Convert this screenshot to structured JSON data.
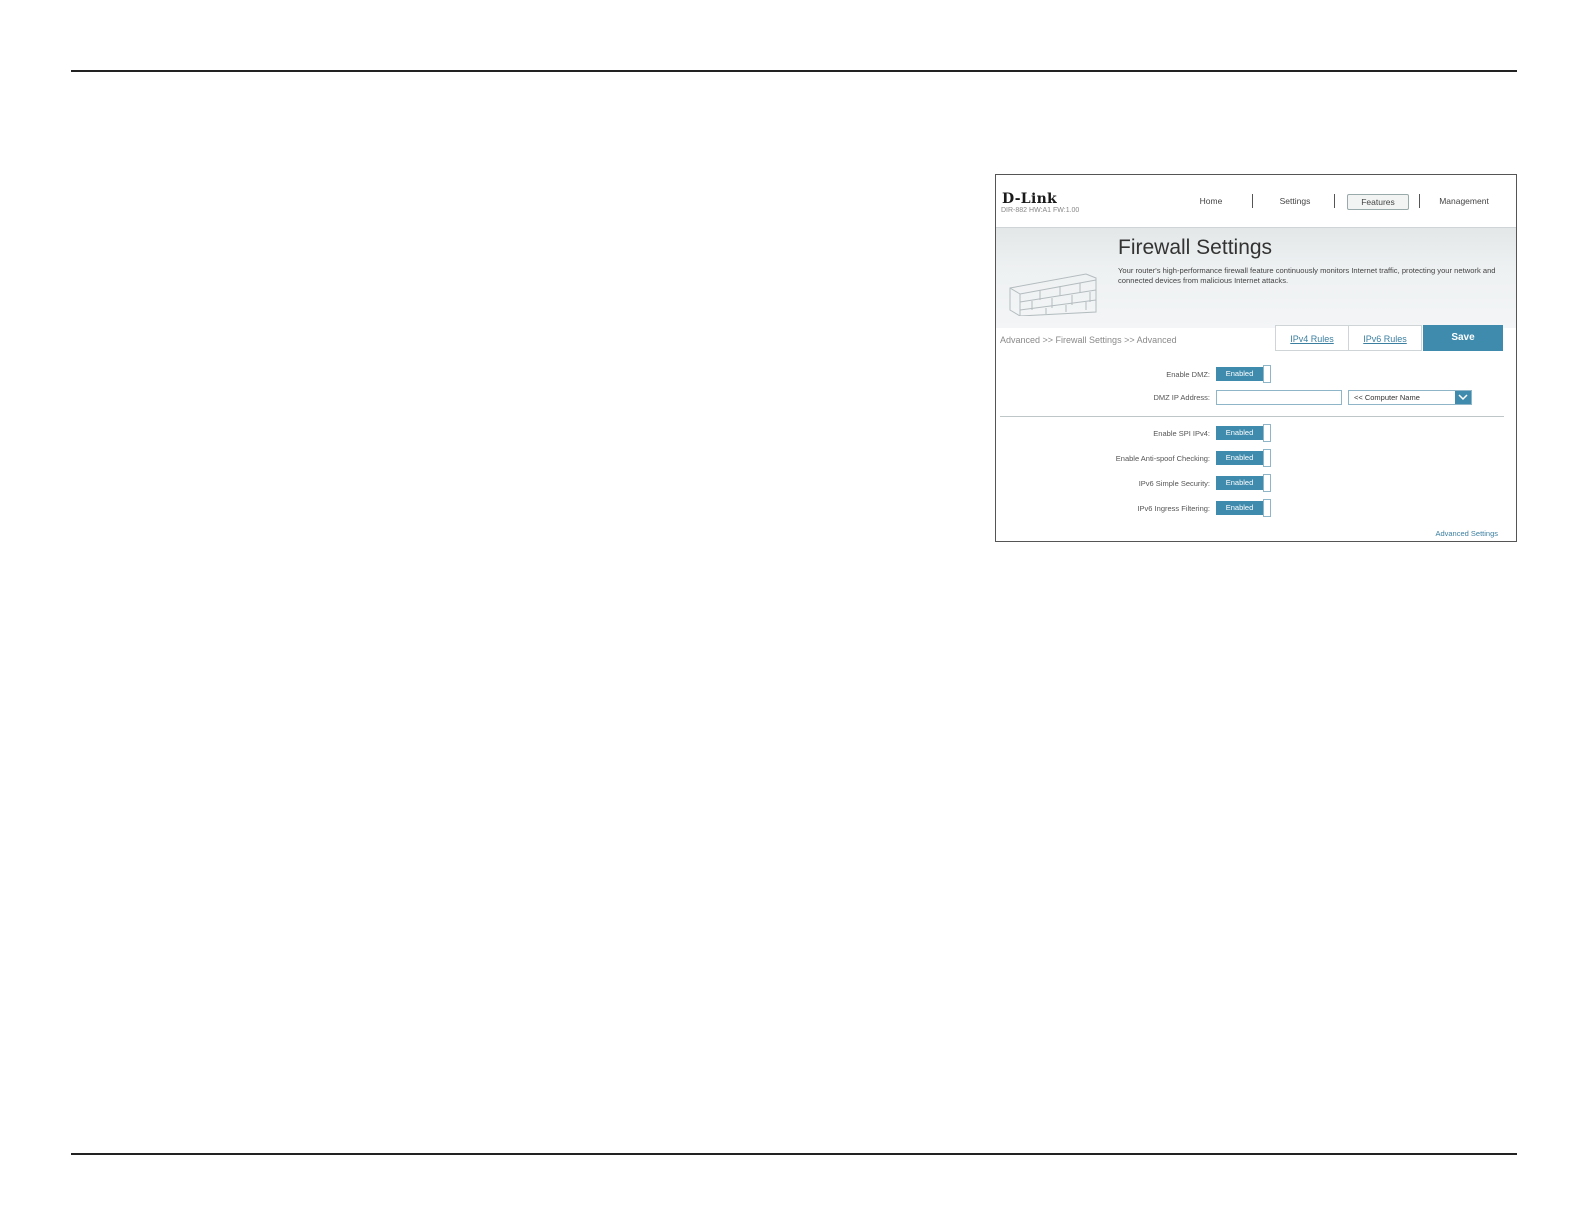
{
  "router": {
    "brand": "D-Link",
    "model": "DIR-882 HW:A1 FW:1.00",
    "nav": [
      "Home",
      "Settings",
      "Features",
      "Management"
    ],
    "active_nav": "Features",
    "banner": {
      "title": "Firewall Settings",
      "description": "Your router's high-performance firewall feature continuously monitors Internet traffic, protecting your network and connected devices from malicious Internet attacks."
    },
    "breadcrumb": "Advanced >> Firewall Settings >> Advanced",
    "tabs": {
      "ipv4": "IPv4 Rules",
      "ipv6": "IPv6 Rules"
    },
    "save_label": "Save",
    "dmz": {
      "enable_label": "Enable DMZ:",
      "enable_value": "Enabled",
      "ip_label": "DMZ IP Address:",
      "ip_value": "",
      "computer_select": "<< Computer Name"
    },
    "settings": [
      {
        "label": "Enable SPI IPv4:",
        "value": "Enabled"
      },
      {
        "label": "Enable Anti-spoof Checking:",
        "value": "Enabled"
      },
      {
        "label": "IPv6 Simple Security:",
        "value": "Enabled"
      },
      {
        "label": "IPv6 Ingress Filtering:",
        "value": "Enabled"
      }
    ],
    "advanced_link": "Advanced Settings"
  },
  "colors": {
    "accent": "#3e8bad",
    "link": "#3b7fa0",
    "rule": "#222222"
  }
}
